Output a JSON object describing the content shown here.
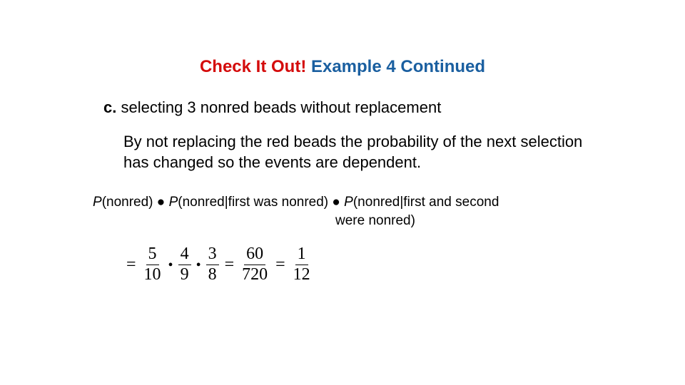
{
  "title": {
    "part1": "Check It Out!",
    "part2": " Example 4 Continued"
  },
  "problem": {
    "label": "c.",
    "text": " selecting 3 nonred beads without replacement"
  },
  "explain": "By not replacing the red beads the probability of the next selection has changed so the events are dependent.",
  "formula": {
    "p": "P",
    "t1": "(nonred) ",
    "dot": "●",
    "t2": "(nonred|first was nonred) ",
    "t3": "(nonred|first and second",
    "t4": "were nonred)"
  },
  "calc": {
    "eq": "=",
    "dot": "•",
    "f1": {
      "num": "5",
      "den": "10"
    },
    "f2": {
      "num": "4",
      "den": "9"
    },
    "f3": {
      "num": "3",
      "den": "8"
    },
    "f4": {
      "num": "60",
      "den": "720"
    },
    "f5": {
      "num": "1",
      "den": "12"
    }
  }
}
